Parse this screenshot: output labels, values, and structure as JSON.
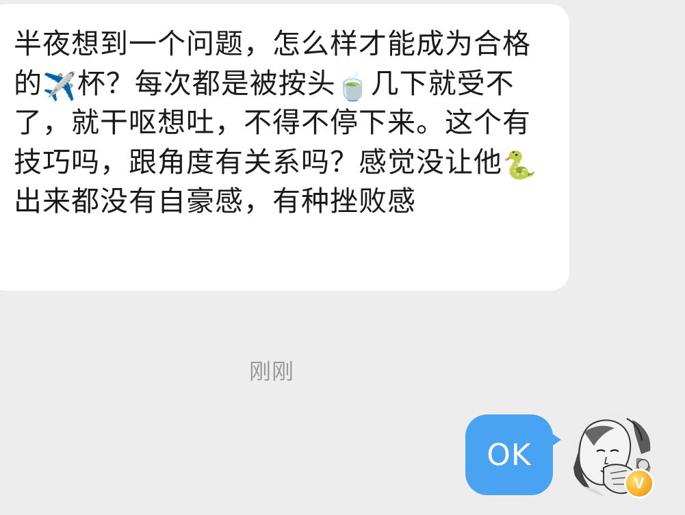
{
  "conversation": {
    "incoming_message": {
      "segments": [
        {
          "type": "text",
          "value": "半夜想到一个问题，怎么样才能成为合格的"
        },
        {
          "type": "emoji",
          "value": "✈️",
          "icon": "airplane-icon"
        },
        {
          "type": "text",
          "value": "杯？每次都是被按头"
        },
        {
          "type": "emoji",
          "value": "🍵",
          "icon": "tea-icon"
        },
        {
          "type": "text",
          "value": "几下就受不了，就干呕想吐，不得不停下来。这个有技巧吗，跟角度有关系吗？感觉没让他"
        },
        {
          "type": "emoji",
          "value": "🐍",
          "icon": "snake-icon"
        },
        {
          "type": "text",
          "value": "出来都没有自豪感，有种挫败感"
        }
      ]
    },
    "timestamp": "刚刚",
    "outgoing_message": {
      "text": "OK"
    },
    "avatar": {
      "icon": "user-avatar",
      "badge_letter": "V",
      "badge_color": "#f4a51c"
    }
  },
  "colors": {
    "background": "#ededed",
    "incoming_bubble": "#ffffff",
    "outgoing_bubble": "#4aa3f2",
    "timestamp_text": "#9a9a9a"
  }
}
